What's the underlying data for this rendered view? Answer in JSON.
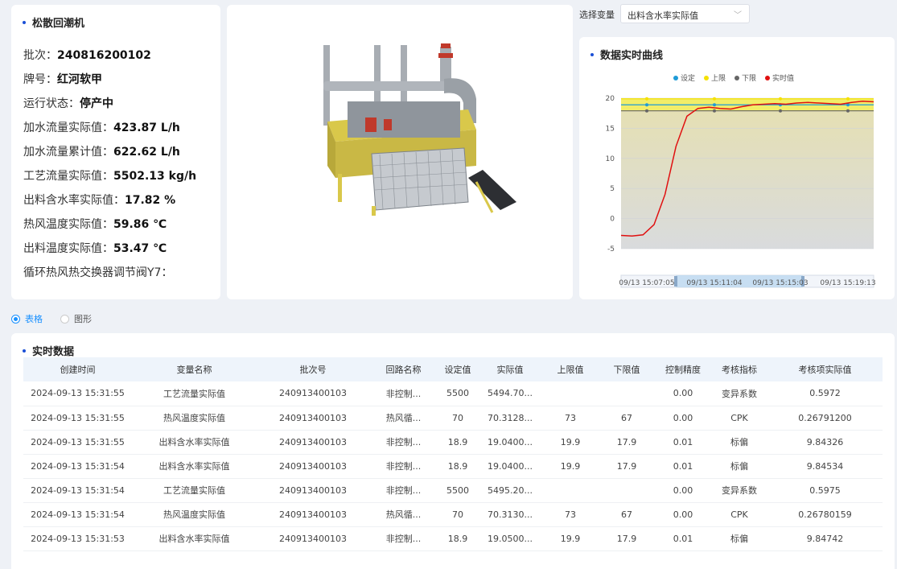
{
  "info": {
    "title": "松散回潮机",
    "rows": [
      {
        "label": "批次：",
        "value": "240816200102"
      },
      {
        "label": "牌号：",
        "value": "红河软甲"
      },
      {
        "label": "运行状态：",
        "value": "停产中"
      },
      {
        "label": "加水流量实际值：",
        "value": "423.87 L/h"
      },
      {
        "label": "加水流量累计值：",
        "value": "622.62 L/h"
      },
      {
        "label": "工艺流量实际值：",
        "value": "5502.13 kg/h"
      },
      {
        "label": "出料含水率实际值：",
        "value": "17.82 %"
      },
      {
        "label": "热风温度实际值：",
        "value": "59.86 ℃"
      },
      {
        "label": "出料温度实际值：",
        "value": "53.47 ℃"
      },
      {
        "label": "循环热风热交换器调节阀Y7：",
        "value": ""
      }
    ]
  },
  "selector": {
    "label": "选择变量",
    "value": "出料含水率实际值",
    "icon": "chevron-down-icon"
  },
  "view_mode": {
    "table_label": "表格",
    "graph_label": "图形",
    "selected": "表格"
  },
  "chart_title": "数据实时曲线",
  "chart_data": {
    "type": "line",
    "x": [
      "09/13 15:07:05",
      "09/13 15:11:04",
      "09/13 15:15:03",
      "09/13 15:19:13"
    ],
    "ylim": [
      -5,
      20
    ],
    "yticks": [
      -5,
      0,
      5,
      10,
      15,
      20
    ],
    "legend_position": "top-center",
    "series": [
      {
        "name": "设定",
        "color": "#1e9bd7",
        "values": [
          null,
          18.9,
          18.9,
          18.9,
          18.9
        ]
      },
      {
        "name": "上限",
        "color": "#f5e100",
        "values": [
          null,
          19.9,
          19.9,
          19.9,
          19.9
        ]
      },
      {
        "name": "下限",
        "color": "#666666",
        "values": [
          null,
          17.9,
          17.9,
          17.9,
          17.9
        ]
      },
      {
        "name": "实时值",
        "color": "#e01010",
        "values": [
          -2.8,
          -2.9,
          -2.7,
          -1.0,
          4.0,
          12.0,
          17.0,
          18.3,
          18.5,
          18.3,
          18.2,
          18.6,
          18.9,
          19.0,
          19.1,
          19.0,
          19.2,
          19.3,
          19.2,
          19.1,
          19.0,
          19.3,
          19.5,
          19.4
        ]
      }
    ],
    "zoom_window": [
      "09/13 15:11:04",
      "09/13 15:15:03"
    ]
  },
  "table": {
    "title": "实时数据",
    "columns": [
      "创建时间",
      "变量名称",
      "批次号",
      "回路名称",
      "设定值",
      "实际值",
      "上限值",
      "下限值",
      "控制精度",
      "考核指标",
      "考核项实际值"
    ],
    "rows": [
      [
        "2024-09-13 15:31:55",
        "工艺流量实际值",
        "240913400103",
        "非控制...",
        "5500",
        "5494.70...",
        "",
        "",
        "0.00",
        "变异系数",
        "0.5972"
      ],
      [
        "2024-09-13 15:31:55",
        "热风温度实际值",
        "240913400103",
        "热风循...",
        "70",
        "70.3128...",
        "73",
        "67",
        "0.00",
        "CPK",
        "0.26791200"
      ],
      [
        "2024-09-13 15:31:55",
        "出料含水率实际值",
        "240913400103",
        "非控制...",
        "18.9",
        "19.0400...",
        "19.9",
        "17.9",
        "0.01",
        "标偏",
        "9.84326"
      ],
      [
        "2024-09-13 15:31:54",
        "出料含水率实际值",
        "240913400103",
        "非控制...",
        "18.9",
        "19.0400...",
        "19.9",
        "17.9",
        "0.01",
        "标偏",
        "9.84534"
      ],
      [
        "2024-09-13 15:31:54",
        "工艺流量实际值",
        "240913400103",
        "非控制...",
        "5500",
        "5495.20...",
        "",
        "",
        "0.00",
        "变异系数",
        "0.5975"
      ],
      [
        "2024-09-13 15:31:54",
        "热风温度实际值",
        "240913400103",
        "热风循...",
        "70",
        "70.3130...",
        "73",
        "67",
        "0.00",
        "CPK",
        "0.26780159"
      ],
      [
        "2024-09-13 15:31:53",
        "出料含水率实际值",
        "240913400103",
        "非控制...",
        "18.9",
        "19.0500...",
        "19.9",
        "17.9",
        "0.01",
        "标偏",
        "9.84742"
      ]
    ]
  }
}
